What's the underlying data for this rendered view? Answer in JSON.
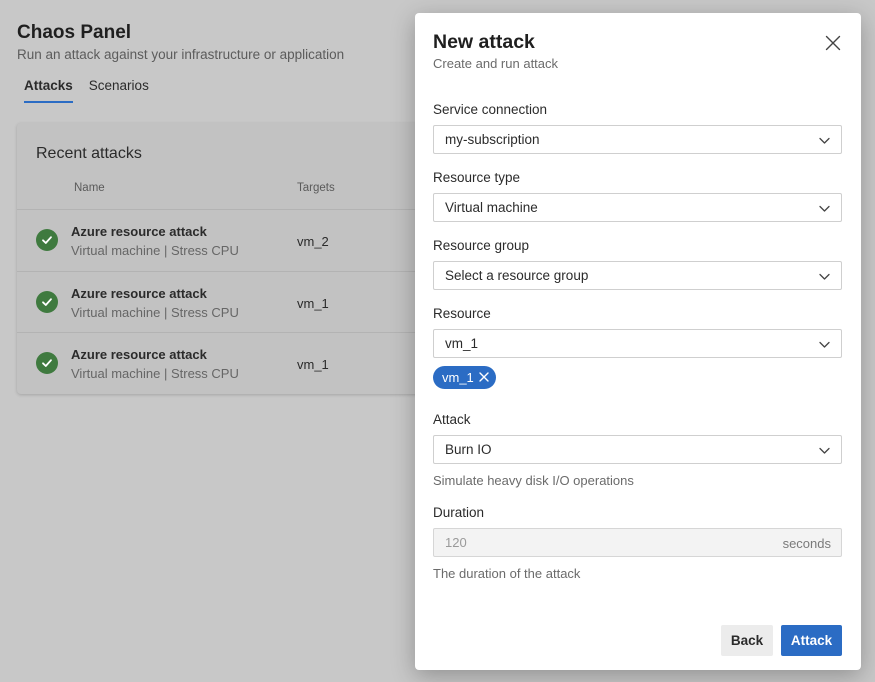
{
  "page": {
    "title": "Chaos Panel",
    "subtitle": "Run an attack against your infrastructure or application",
    "tabs": [
      {
        "label": "Attacks",
        "active": true
      },
      {
        "label": "Scenarios",
        "active": false
      }
    ]
  },
  "recent": {
    "title": "Recent attacks",
    "columns": {
      "name": "Name",
      "targets": "Targets"
    },
    "rows": [
      {
        "title": "Azure resource attack",
        "subtitle": "Virtual machine | Stress CPU",
        "target": "vm_2",
        "status_icon": "check-circle-icon"
      },
      {
        "title": "Azure resource attack",
        "subtitle": "Virtual machine | Stress CPU",
        "target": "vm_1",
        "status_icon": "check-circle-icon"
      },
      {
        "title": "Azure resource attack",
        "subtitle": "Virtual machine | Stress CPU",
        "target": "vm_1",
        "status_icon": "check-circle-icon"
      }
    ]
  },
  "panel": {
    "title": "New attack",
    "subtitle": "Create and run attack",
    "close_icon": "close-icon",
    "fields": {
      "service_connection": {
        "label": "Service connection",
        "value": "my-subscription"
      },
      "resource_type": {
        "label": "Resource type",
        "value": "Virtual machine"
      },
      "resource_group": {
        "label": "Resource group",
        "value": "Select a resource group"
      },
      "resource": {
        "label": "Resource",
        "value": "vm_1",
        "selected_tags": [
          "vm_1"
        ]
      },
      "attack": {
        "label": "Attack",
        "value": "Burn IO",
        "helper": "Simulate heavy disk I/O operations"
      },
      "duration": {
        "label": "Duration",
        "value": "120",
        "unit": "seconds",
        "helper": "The duration of the attack"
      }
    },
    "buttons": {
      "back": "Back",
      "attack": "Attack"
    }
  },
  "colors": {
    "accent": "#2b6cc4",
    "success": "#3f7a3f",
    "overlay": "#c8c8c8"
  }
}
